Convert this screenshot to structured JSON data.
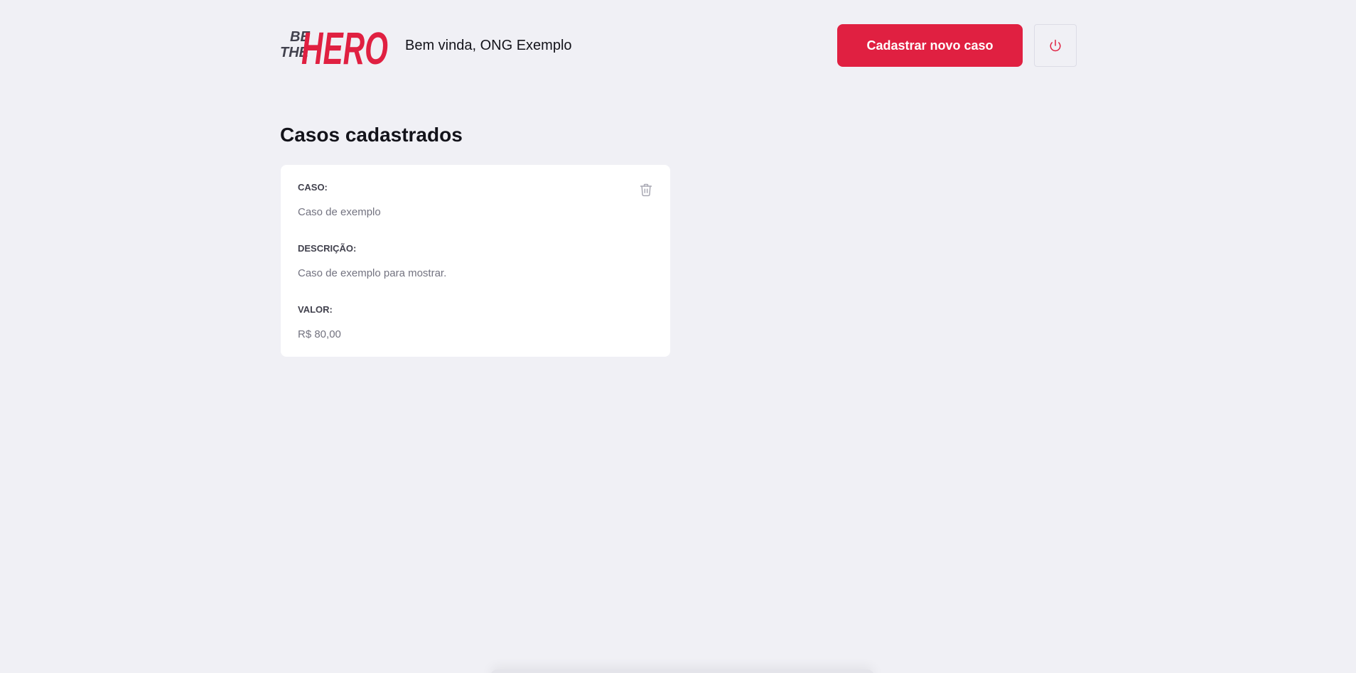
{
  "header": {
    "logo": {
      "line1": "BE",
      "line2": "THE",
      "word": "HERO"
    },
    "greeting": "Bem vinda, ONG Exemplo",
    "new_case_label": "Cadastrar novo caso",
    "logout_icon": "power-icon"
  },
  "main": {
    "title": "Casos cadastrados",
    "cases": [
      {
        "case_label": "CASO:",
        "case_value": "Caso de exemplo",
        "description_label": "DESCRIÇÃO:",
        "description_value": "Caso de exemplo para mostrar.",
        "value_label": "VALOR:",
        "value_value": "R$ 80,00",
        "delete_icon": "trash-icon"
      }
    ]
  },
  "colors": {
    "accent": "#e02041",
    "background": "#f0f0f5",
    "text_dark": "#13131a",
    "text_muted": "#737380",
    "icon_gray": "#a8a8b3"
  }
}
